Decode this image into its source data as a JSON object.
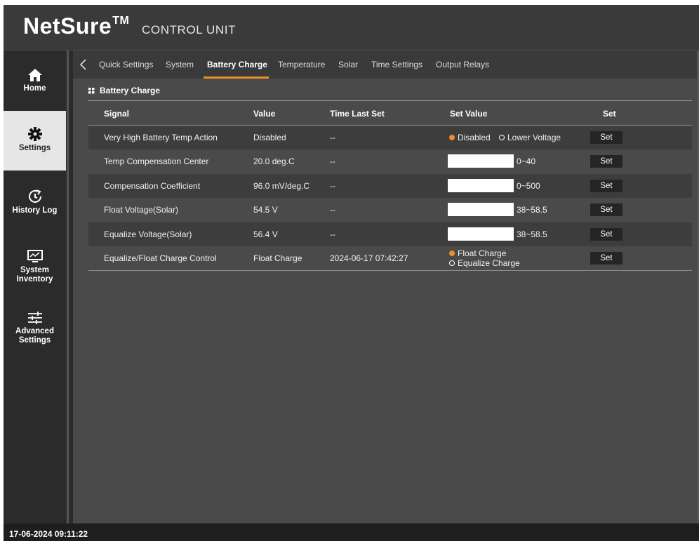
{
  "header": {
    "brand": "NetSure",
    "trademark": "TM",
    "subtitle": "CONTROL UNIT"
  },
  "sidebar": {
    "items": [
      {
        "label_lines": [
          "Home"
        ],
        "icon": "home-icon",
        "active": false
      },
      {
        "label_lines": [
          "Settings"
        ],
        "icon": "gear-icon",
        "active": true
      },
      {
        "label_lines": [
          "History Log"
        ],
        "icon": "history-icon",
        "active": false
      },
      {
        "label_lines": [
          "System",
          "Inventory"
        ],
        "icon": "monitor-icon",
        "active": false
      },
      {
        "label_lines": [
          "Advanced",
          "Settings"
        ],
        "icon": "sliders-icon",
        "active": false
      }
    ]
  },
  "tabs": {
    "items": [
      "Quick Settings",
      "System",
      "Battery Charge",
      "Temperature",
      "Solar",
      "Time Settings",
      "Output Relays"
    ],
    "active": "Battery Charge"
  },
  "section": {
    "title": "Battery Charge"
  },
  "table": {
    "headers": [
      "Signal",
      "Value",
      "Time Last Set",
      "Set Value",
      "Set"
    ],
    "rows": [
      {
        "signal": "Very High Battery Temp Action",
        "value": "Disabled",
        "time_last_set": "--",
        "control": "radio",
        "options": [
          "Disabled",
          "Lower Voltage"
        ],
        "selected": "Disabled",
        "set_label": "Set"
      },
      {
        "signal": "Temp Compensation Center",
        "value": "20.0 deg.C",
        "time_last_set": "--",
        "control": "input",
        "input_value": "",
        "range": "0~40",
        "set_label": "Set"
      },
      {
        "signal": "Compensation Coefficient",
        "value": "96.0 mV/deg.C",
        "time_last_set": "--",
        "control": "input",
        "input_value": "",
        "range": "0~500",
        "set_label": "Set"
      },
      {
        "signal": "Float Voltage(Solar)",
        "value": "54.5 V",
        "time_last_set": "--",
        "control": "input",
        "input_value": "",
        "range": "38~58.5",
        "set_label": "Set"
      },
      {
        "signal": "Equalize Voltage(Solar)",
        "value": "56.4 V",
        "time_last_set": "--",
        "control": "input",
        "input_value": "",
        "range": "38~58.5",
        "set_label": "Set"
      },
      {
        "signal": "Equalize/Float Charge Control",
        "value": "Float Charge",
        "time_last_set": "2024-06-17 07:42:27",
        "control": "radio-stacked",
        "options": [
          "Float Charge",
          "Equalize Charge"
        ],
        "selected": "Float Charge",
        "set_label": "Set"
      }
    ]
  },
  "footer": {
    "datetime": "17-06-2024 09:11:22"
  },
  "colors": {
    "accent": "#e8912b",
    "header_bg": "#3a3a3a",
    "content_bg": "#4a4a4a",
    "active_sidebar": "#e6e6e6"
  }
}
